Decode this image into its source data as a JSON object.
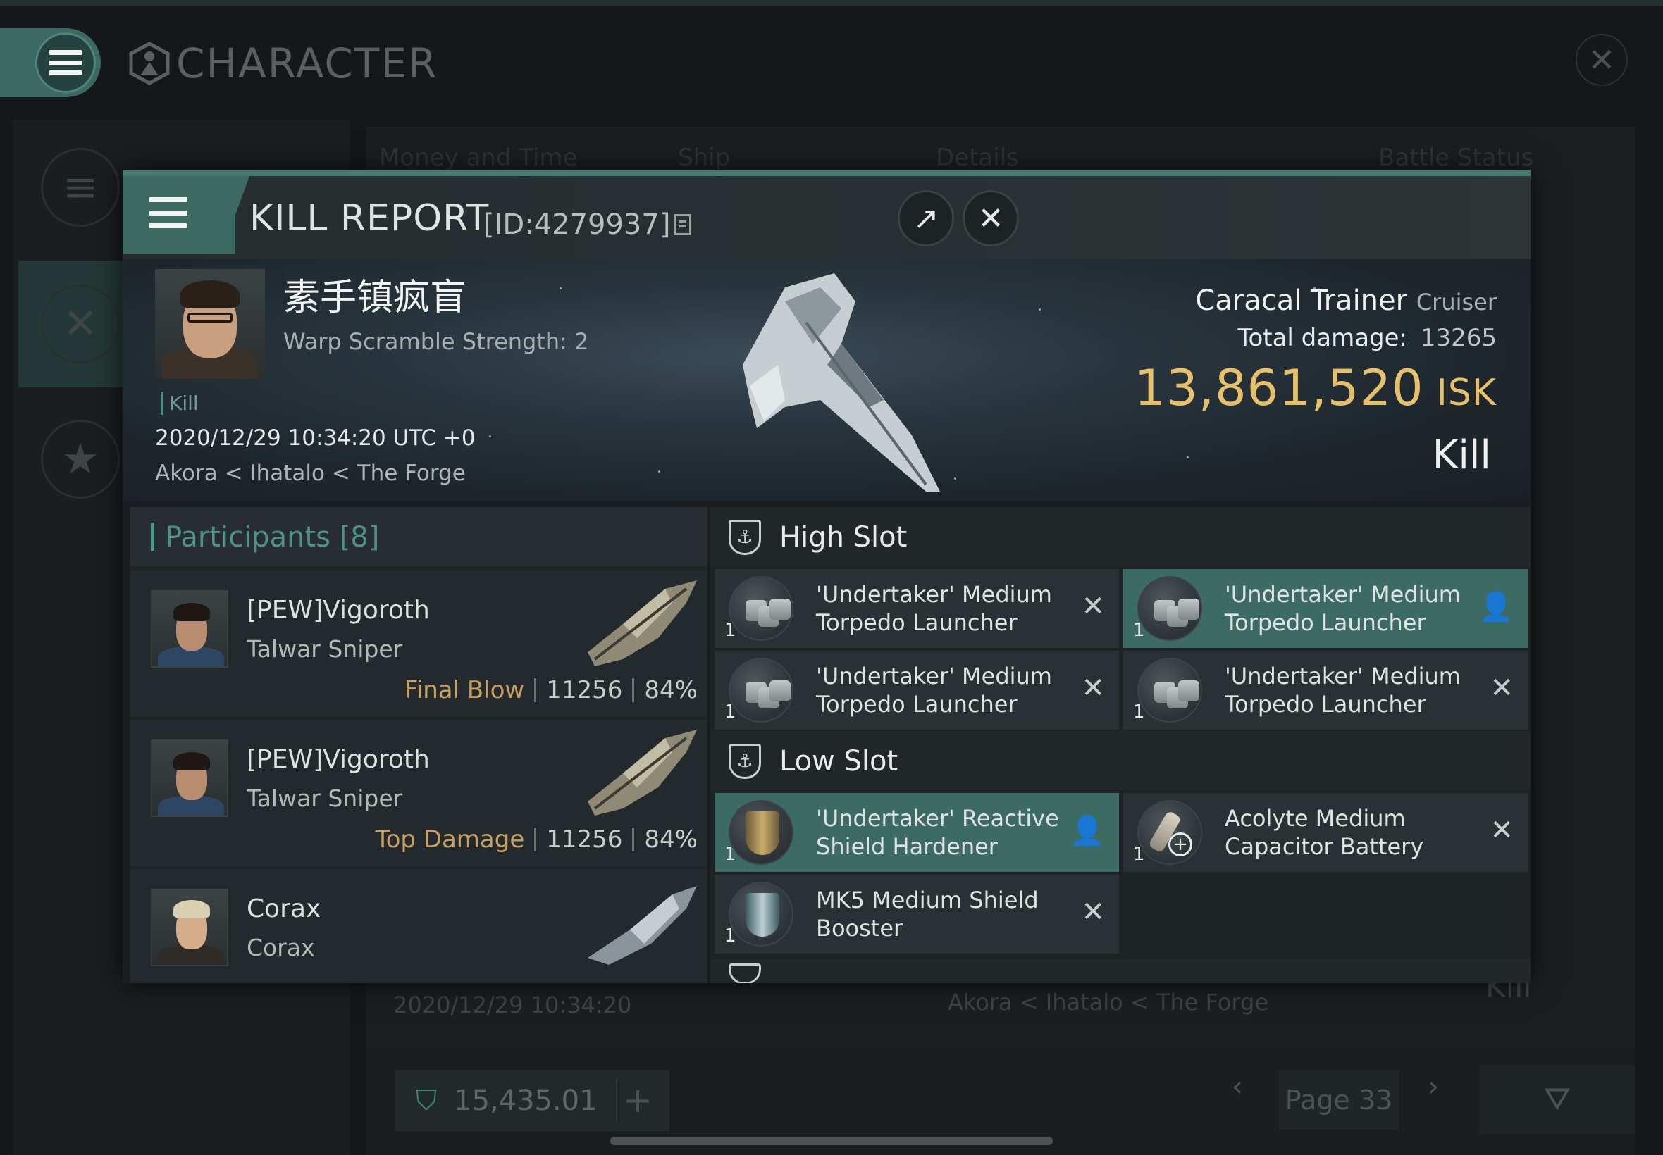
{
  "background": {
    "title": "CHARACTER",
    "tab_headers": [
      "Money and Time",
      "Ship",
      "Details",
      "Battle Status"
    ],
    "row_time": "2020/12/29  10:34:20",
    "row_location": "Akora < Ihatalo < The Forge",
    "row_status": "Kill",
    "isk_balance": "15,435.01",
    "page_label": "Page 33",
    "icons": {
      "menu": "hamburger-icon",
      "character": "character-emblem-icon",
      "close": "close-icon",
      "nav_list": "list-icon",
      "nav_combat": "crossed-swords-icon",
      "nav_star": "star-icon",
      "wallet": "wallet-icon",
      "add": "plus-icon",
      "prev": "chevron-left-icon",
      "next": "chevron-right-icon",
      "filter": "filter-icon"
    }
  },
  "dialog": {
    "title": "KILL REPORT",
    "id_label": "[ID:4279937]",
    "victim": {
      "name": "素手镇疯盲",
      "warp_scramble": "Warp Scramble Strength: 2",
      "tag": "Kill",
      "timestamp": "2020/12/29 10:34:20 UTC +0",
      "location": "Akora < Ihatalo < The Forge"
    },
    "ship": {
      "name": "Caracal Trainer",
      "class": "Cruiser",
      "total_damage_label": "Total damage:",
      "total_damage": "13265",
      "isk_value": "13,861,520",
      "isk_unit": "ISK",
      "result": "Kill"
    },
    "participants": {
      "title": "Participants [8]",
      "rows": [
        {
          "name": "[PEW]Vigoroth",
          "ship": "Talwar Sniper",
          "tag": "Final Blow",
          "damage": "11256",
          "percent": "84%"
        },
        {
          "name": "[PEW]Vigoroth",
          "ship": "Talwar Sniper",
          "tag": "Top Damage",
          "damage": "11256",
          "percent": "84%"
        },
        {
          "name": "Corax",
          "ship": "Corax",
          "tag": "",
          "damage": "",
          "percent": ""
        }
      ]
    },
    "fitting": {
      "high_slot_label": "High Slot",
      "low_slot_label": "Low Slot",
      "high": [
        {
          "line1": "'Undertaker' Medium",
          "line2": "Torpedo Launcher",
          "qty": "1",
          "status": "destroyed"
        },
        {
          "line1": "'Undertaker' Medium",
          "line2": "Torpedo Launcher",
          "qty": "1",
          "status": "dropped"
        },
        {
          "line1": "'Undertaker' Medium",
          "line2": "Torpedo Launcher",
          "qty": "1",
          "status": "destroyed"
        },
        {
          "line1": "'Undertaker' Medium",
          "line2": "Torpedo Launcher",
          "qty": "1",
          "status": "destroyed"
        }
      ],
      "low": [
        {
          "line1": "'Undertaker' Reactive",
          "line2": "Shield Hardener",
          "qty": "1",
          "status": "dropped"
        },
        {
          "line1": "Acolyte Medium",
          "line2": "Capacitor Battery",
          "qty": "1",
          "status": "destroyed"
        },
        {
          "line1": "MK5 Medium Shield",
          "line2": "Booster",
          "qty": "1",
          "status": "destroyed"
        }
      ]
    }
  },
  "colors": {
    "accent": "#3d6a61",
    "isk_gold": "#e6c06a",
    "final_blow": "#c9a060",
    "participants_title": "#4d9485"
  }
}
